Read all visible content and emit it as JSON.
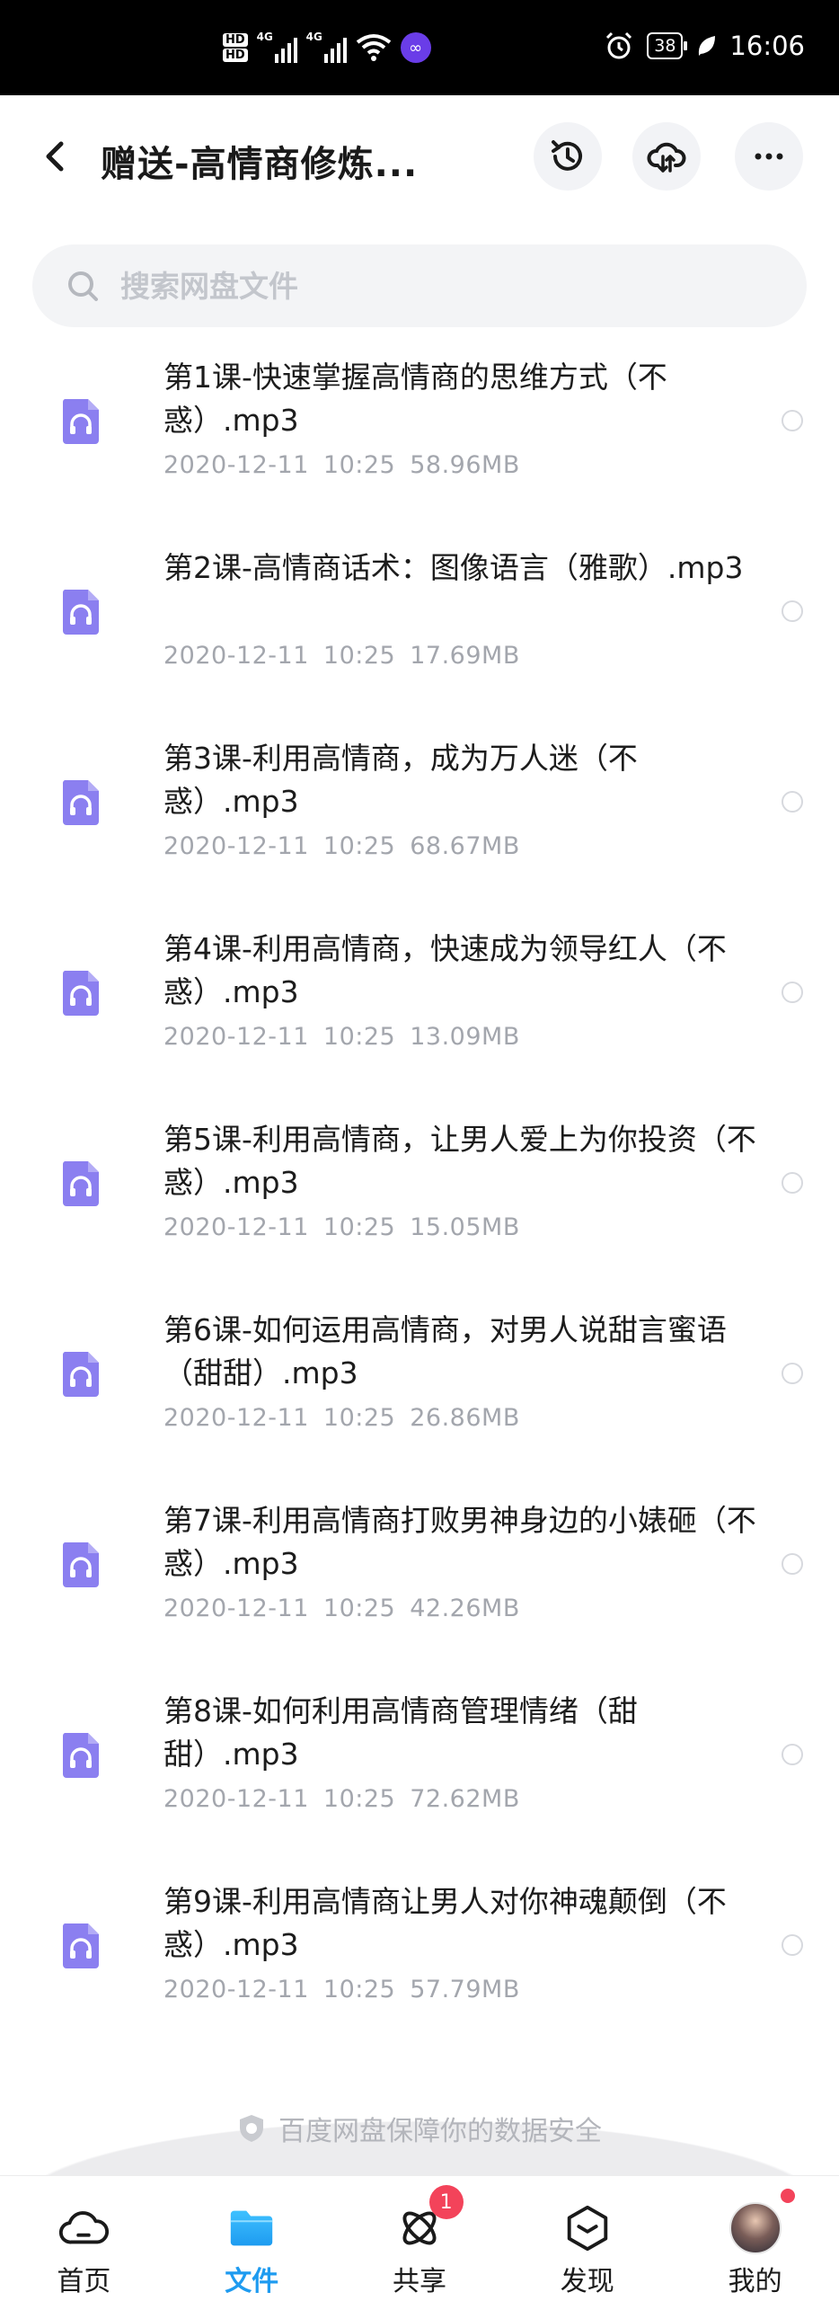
{
  "status_bar": {
    "hd1": "HD",
    "hd2": "HD",
    "net1": "4G",
    "net2": "4G",
    "battery": "38",
    "time": "16:06"
  },
  "header": {
    "title": "赠送-高情商修炼..."
  },
  "search": {
    "placeholder": "搜索网盘文件"
  },
  "files": [
    {
      "name": "第1课-快速掌握高情商的思维方式（不惑）.mp3",
      "date": "2020-12-11",
      "time": "10:25",
      "size": "58.96MB"
    },
    {
      "name": "第2课-高情商话术：图像语言（雅歌）.mp3",
      "date": "2020-12-11",
      "time": "10:25",
      "size": "17.69MB"
    },
    {
      "name": "第3课-利用高情商，成为万人迷（不惑）.mp3",
      "date": "2020-12-11",
      "time": "10:25",
      "size": "68.67MB"
    },
    {
      "name": "第4课-利用高情商，快速成为领导红人（不惑）.mp3",
      "date": "2020-12-11",
      "time": "10:25",
      "size": "13.09MB"
    },
    {
      "name": "第5课-利用高情商，让男人爱上为你投资（不惑）.mp3",
      "date": "2020-12-11",
      "time": "10:25",
      "size": "15.05MB"
    },
    {
      "name": "第6课-如何运用高情商，对男人说甜言蜜语（甜甜）.mp3",
      "date": "2020-12-11",
      "time": "10:25",
      "size": "26.86MB"
    },
    {
      "name": "第7课-利用高情商打败男神身边的小婊砸（不惑）.mp3",
      "date": "2020-12-11",
      "time": "10:25",
      "size": "42.26MB"
    },
    {
      "name": "第8课-如何利用高情商管理情绪（甜甜）.mp3",
      "date": "2020-12-11",
      "time": "10:25",
      "size": "72.62MB"
    },
    {
      "name": "第9课-利用高情商让男人对你神魂颠倒（不惑）.mp3",
      "date": "2020-12-11",
      "time": "10:25",
      "size": "57.79MB"
    }
  ],
  "safety": {
    "text": "百度网盘保障你的数据安全"
  },
  "nav": {
    "tabs": [
      {
        "label": "首页",
        "icon": "home-cloud-icon"
      },
      {
        "label": "文件",
        "icon": "folder-icon",
        "active": true
      },
      {
        "label": "共享",
        "icon": "share-atom-icon",
        "badge": "1"
      },
      {
        "label": "发现",
        "icon": "discover-icon"
      },
      {
        "label": "我的",
        "icon": "avatar"
      }
    ]
  },
  "colors": {
    "accent": "#1e9bf0",
    "file_icon": "#8b7ff0",
    "badge": "#f3435a",
    "meta_text": "#a3a6ad"
  }
}
